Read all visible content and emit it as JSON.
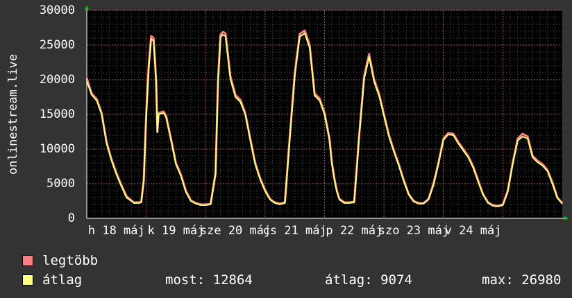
{
  "chart_data": {
    "type": "line",
    "ylabel": "onlinestream.live",
    "ylim": [
      0,
      30000
    ],
    "yticks": [
      0,
      5000,
      10000,
      15000,
      20000,
      25000,
      30000
    ],
    "xlim": [
      0,
      192
    ],
    "xtick_labels": [
      {
        "pos": 12,
        "label": "h 18 máj"
      },
      {
        "pos": 36,
        "label": "k 19 máj"
      },
      {
        "pos": 60,
        "label": "sze 20 máj"
      },
      {
        "pos": 84,
        "label": "cs 21 máj"
      },
      {
        "pos": 108,
        "label": "p 22 máj"
      },
      {
        "pos": 132,
        "label": "szo 23 máj"
      },
      {
        "pos": 156,
        "label": "v 24 máj"
      }
    ],
    "grid": true,
    "series": [
      {
        "name": "legtöbb",
        "color": "#ff7f7f",
        "x": [
          0,
          2,
          4,
          6,
          8,
          10,
          12,
          14,
          16,
          18,
          19,
          20,
          21,
          22,
          23,
          24,
          25,
          26,
          27,
          28,
          28.5,
          29,
          30,
          31,
          32,
          34,
          36,
          38,
          40,
          42,
          44,
          46,
          48,
          50,
          52,
          53,
          54,
          55,
          56,
          58,
          60,
          62,
          64,
          66,
          68,
          70,
          72,
          74,
          75,
          76,
          77,
          78,
          80,
          82,
          84,
          86,
          88,
          90,
          92,
          94,
          96,
          98,
          99,
          100,
          101,
          102,
          104,
          106,
          108,
          110,
          112,
          114,
          116,
          118,
          120,
          122,
          124,
          126,
          128,
          130,
          132,
          134,
          136,
          138,
          140,
          142,
          144,
          146,
          148,
          150,
          152,
          154,
          156,
          158,
          160,
          162,
          164,
          166,
          168,
          170,
          172,
          174,
          176,
          178,
          180,
          182,
          184,
          186,
          188,
          190,
          192
        ],
        "y": [
          20200,
          18000,
          17200,
          15200,
          11000,
          8500,
          6500,
          4800,
          3200,
          2600,
          2300,
          2300,
          2300,
          2400,
          5500,
          15000,
          22000,
          26300,
          26000,
          20000,
          12500,
          15200,
          15300,
          15400,
          14800,
          11500,
          8000,
          6300,
          4000,
          2600,
          2200,
          2000,
          2000,
          2100,
          6500,
          20000,
          26500,
          26900,
          26700,
          20500,
          17800,
          17100,
          15200,
          11500,
          8000,
          5800,
          4100,
          2800,
          2500,
          2300,
          2200,
          2100,
          2300,
          12000,
          21000,
          26600,
          27100,
          25000,
          18000,
          17300,
          15200,
          11500,
          8000,
          5700,
          4000,
          2800,
          2300,
          2300,
          2400,
          12000,
          20500,
          23700,
          20000,
          18000,
          15000,
          12000,
          9800,
          7800,
          5500,
          3500,
          2500,
          2200,
          2200,
          2800,
          5000,
          8000,
          11500,
          12300,
          12200,
          11000,
          10000,
          9000,
          7500,
          5500,
          3500,
          2300,
          1900,
          1800,
          2000,
          4000,
          8000,
          11500,
          12200,
          11800,
          9000,
          8300,
          7800,
          7000,
          5200,
          3000,
          2200
        ]
      },
      {
        "name": "átlag",
        "color": "#ffff80",
        "x": [
          0,
          2,
          4,
          6,
          8,
          10,
          12,
          14,
          16,
          18,
          19,
          20,
          21,
          22,
          23,
          24,
          25,
          26,
          27,
          28,
          28.5,
          29,
          30,
          31,
          32,
          34,
          36,
          38,
          40,
          42,
          44,
          46,
          48,
          50,
          52,
          53,
          54,
          55,
          56,
          58,
          60,
          62,
          64,
          66,
          68,
          70,
          72,
          74,
          75,
          76,
          77,
          78,
          80,
          82,
          84,
          86,
          88,
          90,
          92,
          94,
          96,
          98,
          99,
          100,
          101,
          102,
          104,
          106,
          108,
          110,
          112,
          114,
          116,
          118,
          120,
          122,
          124,
          126,
          128,
          130,
          132,
          134,
          136,
          138,
          140,
          142,
          144,
          146,
          148,
          150,
          152,
          154,
          156,
          158,
          160,
          162,
          164,
          166,
          168,
          170,
          172,
          174,
          176,
          178,
          180,
          182,
          184,
          186,
          188,
          190,
          192
        ],
        "y": [
          19800,
          17800,
          17000,
          15000,
          10800,
          8300,
          6300,
          4600,
          3000,
          2500,
          2200,
          2200,
          2200,
          2300,
          5300,
          14600,
          21500,
          25900,
          25600,
          19600,
          12400,
          15000,
          15100,
          15200,
          14600,
          11300,
          7800,
          6100,
          3800,
          2500,
          2100,
          1900,
          1900,
          2000,
          6300,
          19600,
          26100,
          26500,
          26300,
          20100,
          17500,
          16800,
          15000,
          11300,
          7800,
          5600,
          3900,
          2700,
          2400,
          2200,
          2100,
          2000,
          2200,
          11600,
          20600,
          26200,
          26700,
          24600,
          17700,
          17000,
          15000,
          11300,
          7800,
          5500,
          3800,
          2700,
          2200,
          2200,
          2300,
          11700,
          20100,
          23300,
          19700,
          17700,
          14800,
          11800,
          9600,
          7600,
          5300,
          3400,
          2400,
          2100,
          2100,
          2700,
          4800,
          7800,
          11300,
          12100,
          12000,
          10800,
          9800,
          8800,
          7300,
          5300,
          3400,
          2200,
          1800,
          1700,
          1900,
          3800,
          7800,
          11200,
          11800,
          11500,
          8800,
          8100,
          7600,
          6800,
          5000,
          2900,
          2100
        ]
      }
    ]
  },
  "legend": {
    "items": [
      {
        "label": "legtöbb",
        "color": "#ff7f7f"
      },
      {
        "label": "átlag",
        "color": "#ffff80"
      }
    ],
    "stats": {
      "most": "most: 12864",
      "atlag": "átlag: 9074",
      "max": "max: 26980"
    }
  }
}
